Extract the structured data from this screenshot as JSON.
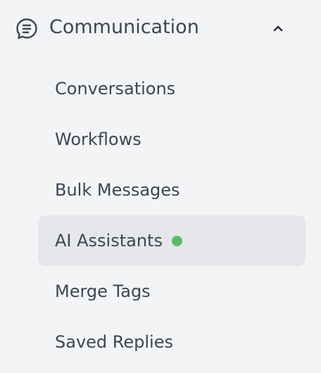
{
  "section": {
    "title": "Communication",
    "icon": "message-lines-icon",
    "toggle_icon": "chevron-up-icon",
    "expanded": true
  },
  "items": [
    {
      "label": "Conversations",
      "active": false
    },
    {
      "label": "Workflows",
      "active": false
    },
    {
      "label": "Bulk Messages",
      "active": false
    },
    {
      "label": "AI Assistants",
      "active": true,
      "status_dot_color": "#5cb96b"
    },
    {
      "label": "Merge Tags",
      "active": false
    },
    {
      "label": "Saved Replies",
      "active": false
    }
  ],
  "colors": {
    "background": "#f3f4f6",
    "text": "#3f4553",
    "active_background": "#e5e7eb",
    "status_green": "#5cb96b"
  }
}
